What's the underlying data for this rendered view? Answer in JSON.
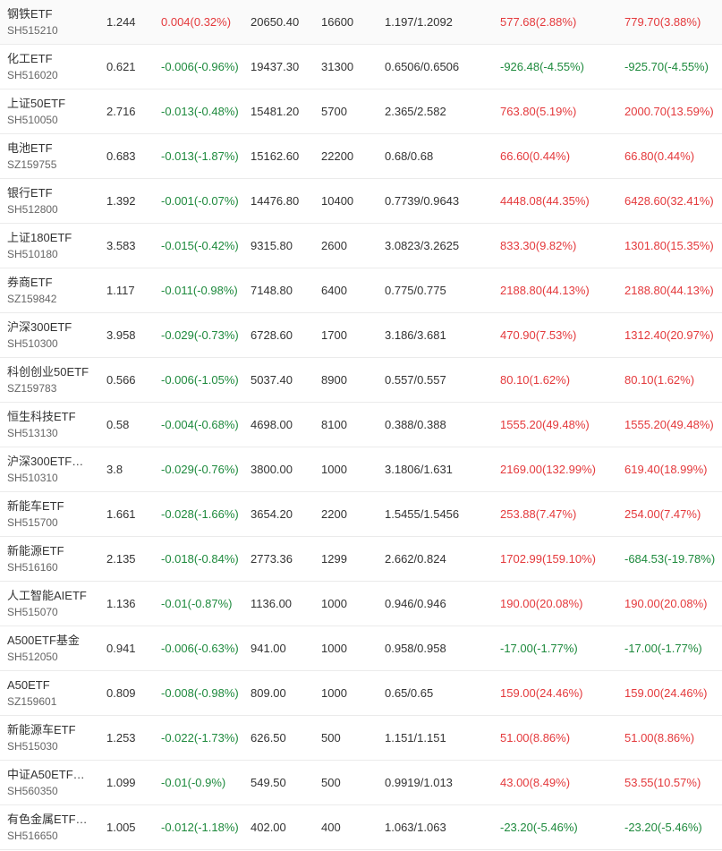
{
  "colors": {
    "up": "#e4393c",
    "down": "#1e8a3d",
    "text": "#333333",
    "subtext": "#666666",
    "divider": "#ebebeb"
  },
  "rows": [
    {
      "name": "钢铁ETF",
      "code": "SH515210",
      "price": "1.244",
      "change": "0.004(0.32%)",
      "change_dir": "pos",
      "value": "20650.40",
      "qty": "16600",
      "cost": "1.197/1.2092",
      "pnl": "577.68(2.88%)",
      "pnl_dir": "pos",
      "total": "779.70(3.88%)",
      "total_dir": "pos"
    },
    {
      "name": "化工ETF",
      "code": "SH516020",
      "price": "0.621",
      "change": "-0.006(-0.96%)",
      "change_dir": "neg",
      "value": "19437.30",
      "qty": "31300",
      "cost": "0.6506/0.6506",
      "pnl": "-926.48(-4.55%)",
      "pnl_dir": "neg",
      "total": "-925.70(-4.55%)",
      "total_dir": "neg"
    },
    {
      "name": "上证50ETF",
      "code": "SH510050",
      "price": "2.716",
      "change": "-0.013(-0.48%)",
      "change_dir": "neg",
      "value": "15481.20",
      "qty": "5700",
      "cost": "2.365/2.582",
      "pnl": "763.80(5.19%)",
      "pnl_dir": "pos",
      "total": "2000.70(13.59%)",
      "total_dir": "pos"
    },
    {
      "name": "电池ETF",
      "code": "SZ159755",
      "price": "0.683",
      "change": "-0.013(-1.87%)",
      "change_dir": "neg",
      "value": "15162.60",
      "qty": "22200",
      "cost": "0.68/0.68",
      "pnl": "66.60(0.44%)",
      "pnl_dir": "pos",
      "total": "66.80(0.44%)",
      "total_dir": "pos"
    },
    {
      "name": "银行ETF",
      "code": "SH512800",
      "price": "1.392",
      "change": "-0.001(-0.07%)",
      "change_dir": "neg",
      "value": "14476.80",
      "qty": "10400",
      "cost": "0.7739/0.9643",
      "pnl": "4448.08(44.35%)",
      "pnl_dir": "pos",
      "total": "6428.60(32.41%)",
      "total_dir": "pos"
    },
    {
      "name": "上证180ETF",
      "code": "SH510180",
      "price": "3.583",
      "change": "-0.015(-0.42%)",
      "change_dir": "neg",
      "value": "9315.80",
      "qty": "2600",
      "cost": "3.0823/3.2625",
      "pnl": "833.30(9.82%)",
      "pnl_dir": "pos",
      "total": "1301.80(15.35%)",
      "total_dir": "pos"
    },
    {
      "name": "券商ETF",
      "code": "SZ159842",
      "price": "1.117",
      "change": "-0.011(-0.98%)",
      "change_dir": "neg",
      "value": "7148.80",
      "qty": "6400",
      "cost": "0.775/0.775",
      "pnl": "2188.80(44.13%)",
      "pnl_dir": "pos",
      "total": "2188.80(44.13%)",
      "total_dir": "pos"
    },
    {
      "name": "沪深300ETF",
      "code": "SH510300",
      "price": "3.958",
      "change": "-0.029(-0.73%)",
      "change_dir": "neg",
      "value": "6728.60",
      "qty": "1700",
      "cost": "3.186/3.681",
      "pnl": "470.90(7.53%)",
      "pnl_dir": "pos",
      "total": "1312.40(20.97%)",
      "total_dir": "pos"
    },
    {
      "name": "科创创业50ETF",
      "code": "SZ159783",
      "price": "0.566",
      "change": "-0.006(-1.05%)",
      "change_dir": "neg",
      "value": "5037.40",
      "qty": "8900",
      "cost": "0.557/0.557",
      "pnl": "80.10(1.62%)",
      "pnl_dir": "pos",
      "total": "80.10(1.62%)",
      "total_dir": "pos"
    },
    {
      "name": "恒生科技ETF",
      "code": "SH513130",
      "price": "0.58",
      "change": "-0.004(-0.68%)",
      "change_dir": "neg",
      "value": "4698.00",
      "qty": "8100",
      "cost": "0.388/0.388",
      "pnl": "1555.20(49.48%)",
      "pnl_dir": "pos",
      "total": "1555.20(49.48%)",
      "total_dir": "pos"
    },
    {
      "name": "沪深300ETF…",
      "code": "SH510310",
      "price": "3.8",
      "change": "-0.029(-0.76%)",
      "change_dir": "neg",
      "value": "3800.00",
      "qty": "1000",
      "cost": "3.1806/1.631",
      "pnl": "2169.00(132.99%)",
      "pnl_dir": "pos",
      "total": "619.40(18.99%)",
      "total_dir": "pos"
    },
    {
      "name": "新能车ETF",
      "code": "SH515700",
      "price": "1.661",
      "change": "-0.028(-1.66%)",
      "change_dir": "neg",
      "value": "3654.20",
      "qty": "2200",
      "cost": "1.5455/1.5456",
      "pnl": "253.88(7.47%)",
      "pnl_dir": "pos",
      "total": "254.00(7.47%)",
      "total_dir": "pos"
    },
    {
      "name": "新能源ETF",
      "code": "SH516160",
      "price": "2.135",
      "change": "-0.018(-0.84%)",
      "change_dir": "neg",
      "value": "2773.36",
      "qty": "1299",
      "cost": "2.662/0.824",
      "pnl": "1702.99(159.10%)",
      "pnl_dir": "pos",
      "total": "-684.53(-19.78%)",
      "total_dir": "neg"
    },
    {
      "name": "人工智能AIETF",
      "code": "SH515070",
      "price": "1.136",
      "change": "-0.01(-0.87%)",
      "change_dir": "neg",
      "value": "1136.00",
      "qty": "1000",
      "cost": "0.946/0.946",
      "pnl": "190.00(20.08%)",
      "pnl_dir": "pos",
      "total": "190.00(20.08%)",
      "total_dir": "pos"
    },
    {
      "name": "A500ETF基金",
      "code": "SH512050",
      "price": "0.941",
      "change": "-0.006(-0.63%)",
      "change_dir": "neg",
      "value": "941.00",
      "qty": "1000",
      "cost": "0.958/0.958",
      "pnl": "-17.00(-1.77%)",
      "pnl_dir": "neg",
      "total": "-17.00(-1.77%)",
      "total_dir": "neg"
    },
    {
      "name": "A50ETF",
      "code": "SZ159601",
      "price": "0.809",
      "change": "-0.008(-0.98%)",
      "change_dir": "neg",
      "value": "809.00",
      "qty": "1000",
      "cost": "0.65/0.65",
      "pnl": "159.00(24.46%)",
      "pnl_dir": "pos",
      "total": "159.00(24.46%)",
      "total_dir": "pos"
    },
    {
      "name": "新能源车ETF",
      "code": "SH515030",
      "price": "1.253",
      "change": "-0.022(-1.73%)",
      "change_dir": "neg",
      "value": "626.50",
      "qty": "500",
      "cost": "1.151/1.151",
      "pnl": "51.00(8.86%)",
      "pnl_dir": "pos",
      "total": "51.00(8.86%)",
      "total_dir": "pos"
    },
    {
      "name": "中证A50ETF…",
      "code": "SH560350",
      "price": "1.099",
      "change": "-0.01(-0.9%)",
      "change_dir": "neg",
      "value": "549.50",
      "qty": "500",
      "cost": "0.9919/1.013",
      "pnl": "43.00(8.49%)",
      "pnl_dir": "pos",
      "total": "53.55(10.57%)",
      "total_dir": "pos"
    },
    {
      "name": "有色金属ETF…",
      "code": "SH516650",
      "price": "1.005",
      "change": "-0.012(-1.18%)",
      "change_dir": "neg",
      "value": "402.00",
      "qty": "400",
      "cost": "1.063/1.063",
      "pnl": "-23.20(-5.46%)",
      "pnl_dir": "neg",
      "total": "-23.20(-5.46%)",
      "total_dir": "neg"
    }
  ]
}
